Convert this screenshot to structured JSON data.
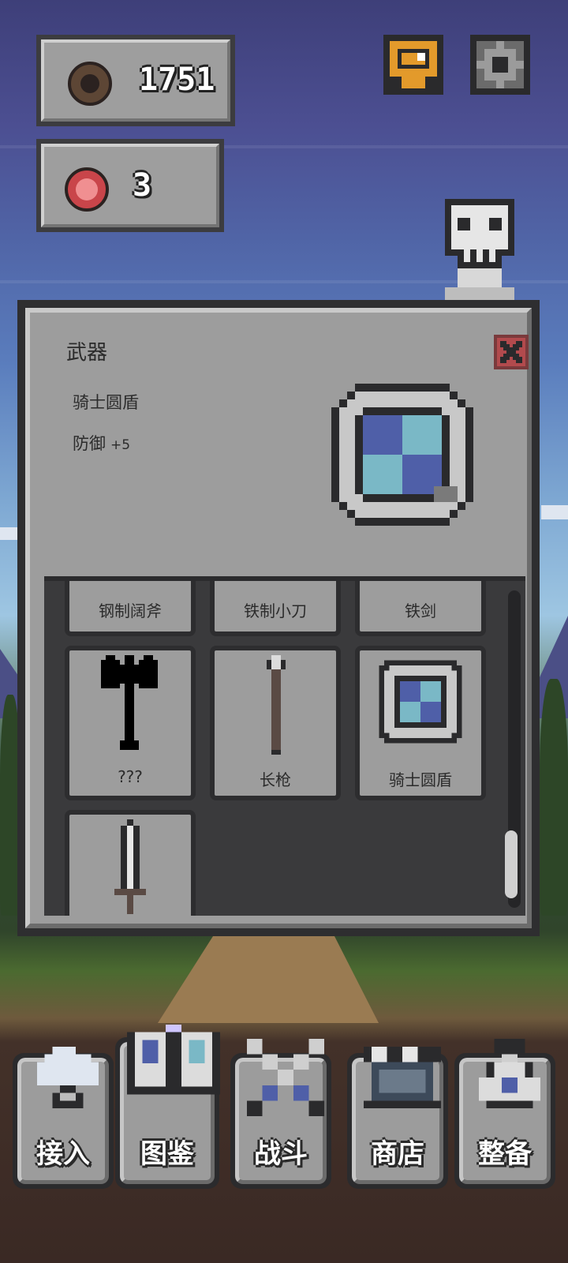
{
  "currency": {
    "coins": "1751",
    "gems": "3"
  },
  "dialog": {
    "title": "武器",
    "item_name": "骑士圆盾",
    "stat_label": "防御",
    "stat_value": "+5"
  },
  "items_row1": [
    "钢制阔斧",
    "铁制小刀",
    "铁剑"
  ],
  "items_row2": [
    "???",
    "长枪",
    "骑士圆盾"
  ],
  "nav": [
    {
      "label": "接入",
      "icon": "cloud-link-icon"
    },
    {
      "label": "图鉴",
      "icon": "book-icon"
    },
    {
      "label": "战斗",
      "icon": "crossed-swords-icon"
    },
    {
      "label": "商店",
      "icon": "shop-icon"
    },
    {
      "label": "整备",
      "icon": "bag-icon"
    }
  ],
  "active_nav": "图鉴",
  "colors": {
    "panel": "#9d9d9d",
    "dark": "#2e2e30",
    "character": "#e39a2b",
    "shield_blue": "#4f5fa8",
    "shield_teal": "#7ab8c6",
    "close_red": "#c9454a"
  }
}
